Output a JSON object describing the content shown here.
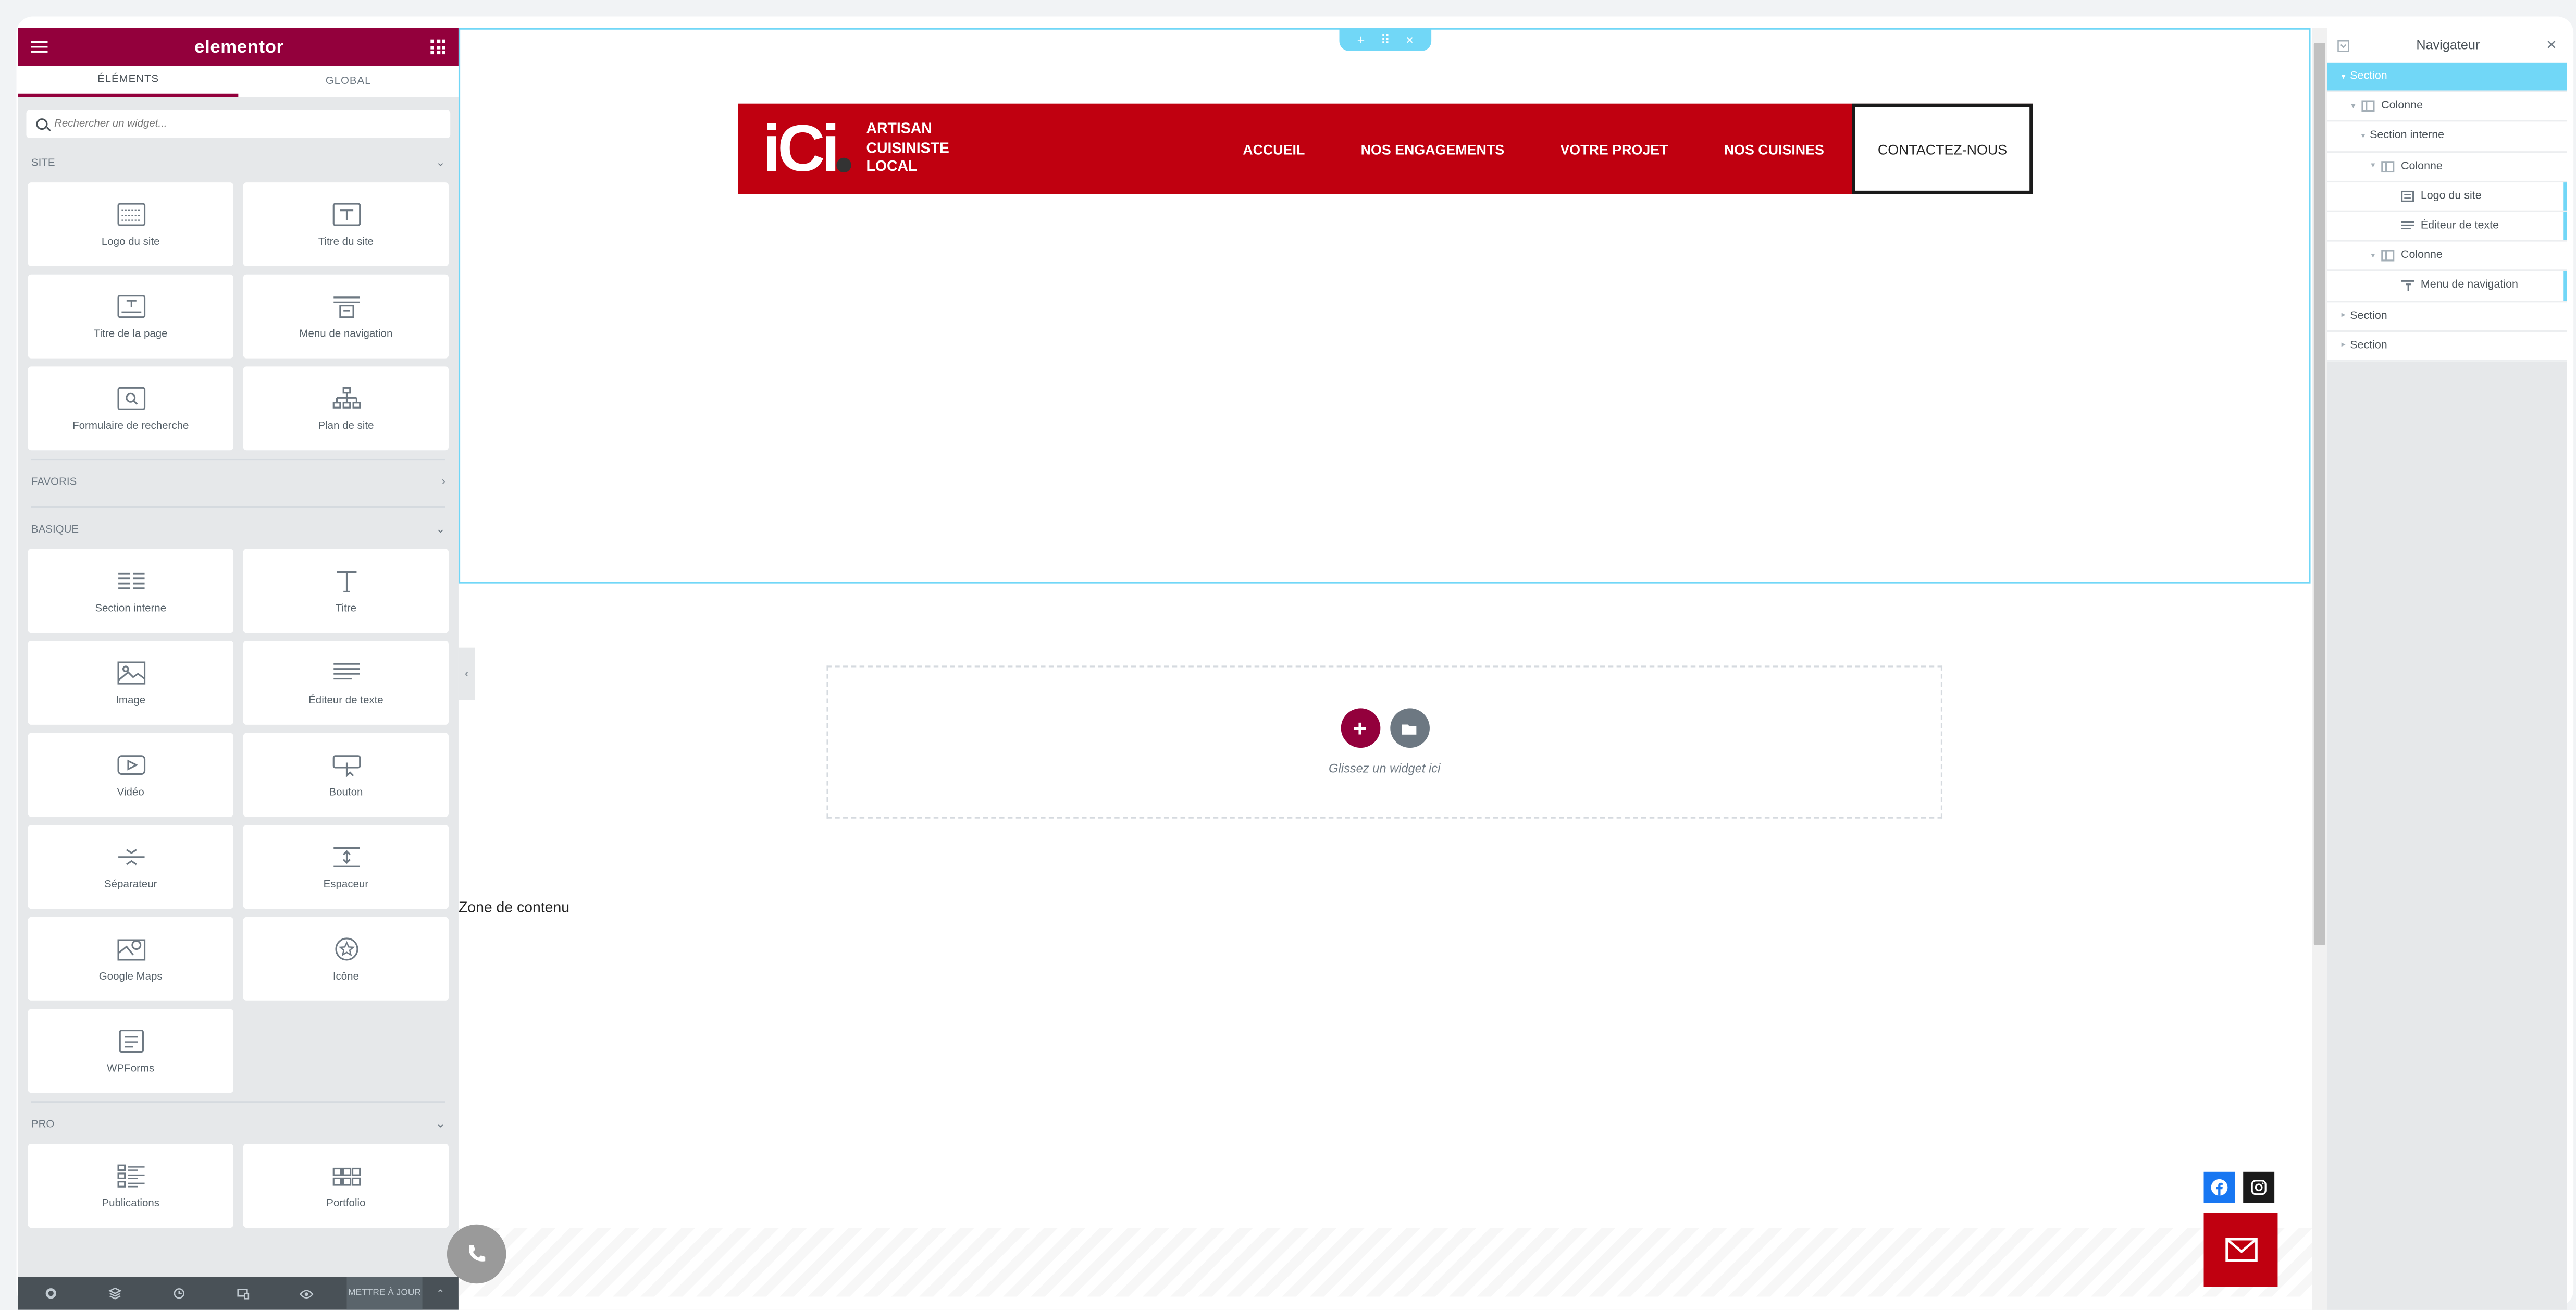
{
  "panel": {
    "brand": "elementor",
    "tabs": [
      {
        "label": "ÉLÉMENTS"
      },
      {
        "label": "GLOBAL"
      }
    ],
    "search_placeholder": "Rechercher un widget...",
    "categories": {
      "site": "SITE",
      "favoris": "FAVORIS",
      "basique": "BASIQUE",
      "pro": "PRO"
    },
    "site_widgets": [
      {
        "label": "Logo du site"
      },
      {
        "label": "Titre du site"
      },
      {
        "label": "Titre de la page"
      },
      {
        "label": "Menu de navigation"
      },
      {
        "label": "Formulaire de recherche"
      },
      {
        "label": "Plan de site"
      }
    ],
    "basic_widgets": [
      {
        "label": "Section interne"
      },
      {
        "label": "Titre"
      },
      {
        "label": "Image"
      },
      {
        "label": "Éditeur de texte"
      },
      {
        "label": "Vidéo"
      },
      {
        "label": "Bouton"
      },
      {
        "label": "Séparateur"
      },
      {
        "label": "Espaceur"
      },
      {
        "label": "Google Maps"
      },
      {
        "label": "Icône"
      },
      {
        "label": "WPForms"
      }
    ],
    "pro_widgets": [
      {
        "label": "Publications"
      },
      {
        "label": "Portfolio"
      }
    ],
    "footer": {
      "update_label": "METTRE À JOUR"
    }
  },
  "canvas": {
    "logo": {
      "mark": "iCi",
      "tagline": [
        "ARTISAN",
        "CUISINISTE",
        "LOCAL"
      ]
    },
    "menu": [
      {
        "label": "ACCUEIL"
      },
      {
        "label": "NOS ENGAGEMENTS"
      },
      {
        "label": "VOTRE PROJET"
      },
      {
        "label": "NOS CUISINES"
      }
    ],
    "cta": "CONTACTEZ-NOUS",
    "dropzone_text": "Glissez un widget ici",
    "zone_label": "Zone de contenu"
  },
  "navigator": {
    "title": "Navigateur",
    "rows": [
      {
        "label": "Section",
        "level": 0,
        "selected": true,
        "icon": "caret-down"
      },
      {
        "label": "Colonne",
        "level": 1,
        "icon": "column-icon"
      },
      {
        "label": "Section interne",
        "level": 2,
        "icon": "none"
      },
      {
        "label": "Colonne",
        "level": 3,
        "icon": "column-icon"
      },
      {
        "label": "Logo du site",
        "level": 4,
        "icon": "logo-icon",
        "widget": true
      },
      {
        "label": "Éditeur de texte",
        "level": 4,
        "icon": "text-icon",
        "widget": true
      },
      {
        "label": "Colonne",
        "level": 3,
        "icon": "column-icon"
      },
      {
        "label": "Menu de navigation",
        "level": 4,
        "icon": "nav-menu-icon",
        "widget": true
      },
      {
        "label": "Section",
        "level": 0,
        "icon": "caret-right"
      },
      {
        "label": "Section",
        "level": 0,
        "icon": "caret-right"
      }
    ]
  },
  "colors": {
    "elementor_brand": "#93003c",
    "site_red": "#c00010",
    "selection_blue": "#71d7f7"
  }
}
